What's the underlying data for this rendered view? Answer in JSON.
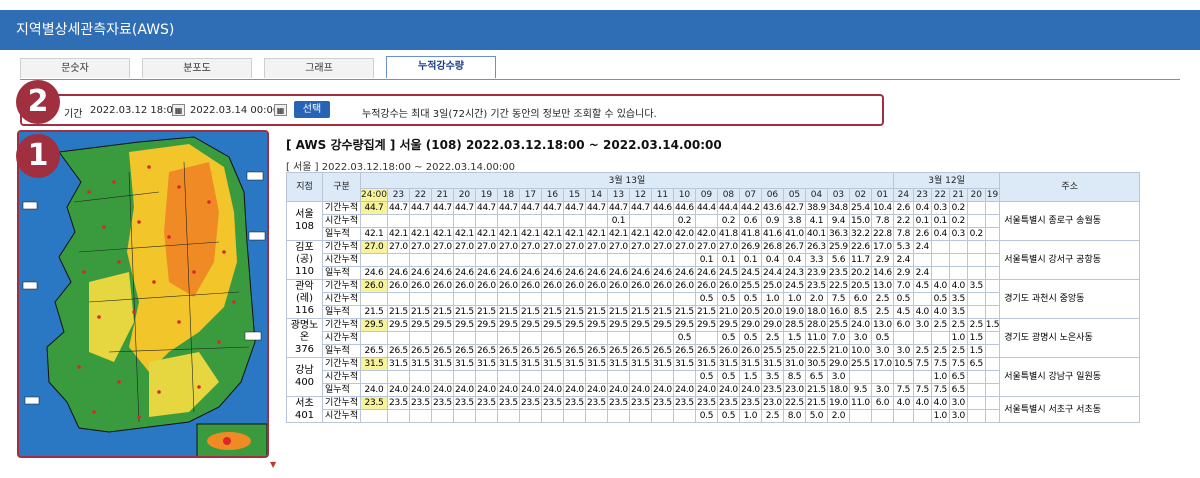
{
  "window_title": "지역별상세관측자료(AWS)",
  "tabs": [
    {
      "label": "문숫자",
      "active": false
    },
    {
      "label": "분포도",
      "active": false
    },
    {
      "label": "그래프",
      "active": false
    },
    {
      "label": "누적강수량",
      "active": true
    }
  ],
  "search": {
    "label": "기간",
    "start": "2022.03.12 18:00",
    "end": "2022.03.14 00:00",
    "button": "선택",
    "info": "누적강수는 최대 3일(72시간) 기간 동안의 정보만 조회할 수 있습니다."
  },
  "badges": [
    "2",
    "1"
  ],
  "colors": {
    "header_blue": "#2f6db5",
    "highlight": "#f7f39a",
    "annotation_red": "#a0303f",
    "button_blue": "#2764b8"
  },
  "report": {
    "title": "[ AWS 강수량집계 ] 서울 (108) 2022.03.12.18:00 ~ 2022.03.14.00:00",
    "subtitle": "[ 서울 ] 2022.03.12.18:00 ~ 2022.03.14.00:00"
  },
  "table": {
    "col_station": "지점",
    "col_kind": "구분",
    "col_address": "주소",
    "day1": "3월 13일",
    "day2": "3월 12일",
    "hours": [
      "24:00",
      "23",
      "22",
      "21",
      "20",
      "19",
      "18",
      "17",
      "16",
      "15",
      "14",
      "13",
      "12",
      "11",
      "10",
      "09",
      "08",
      "07",
      "06",
      "05",
      "04",
      "03",
      "02",
      "01",
      "24",
      "23",
      "22",
      "21",
      "20",
      "19"
    ],
    "stations": [
      {
        "name": "서울\n108",
        "address": "서울특별시 종로구 송월동",
        "rows": [
          {
            "kind": "기간누적",
            "values": [
              "44.7",
              "44.7",
              "44.7",
              "44.7",
              "44.7",
              "44.7",
              "44.7",
              "44.7",
              "44.7",
              "44.7",
              "44.7",
              "44.7",
              "44.7",
              "44.6",
              "44.6",
              "44.4",
              "44.4",
              "44.2",
              "43.6",
              "42.7",
              "38.9",
              "34.8",
              "25.4",
              "10.4",
              "2.6",
              "0.4",
              "0.3",
              "0.2",
              "",
              ""
            ]
          },
          {
            "kind": "시간누적",
            "values": [
              "",
              "",
              "",
              "",
              "",
              "",
              "",
              "",
              "",
              "",
              "",
              "0.1",
              "",
              "",
              "0.2",
              "",
              "0.2",
              "0.6",
              "0.9",
              "3.8",
              "4.1",
              "9.4",
              "15.0",
              "7.8",
              "2.2",
              "0.1",
              "0.1",
              "0.2",
              "",
              ""
            ]
          },
          {
            "kind": "일누적",
            "values": [
              "42.1",
              "42.1",
              "42.1",
              "42.1",
              "42.1",
              "42.1",
              "42.1",
              "42.1",
              "42.1",
              "42.1",
              "42.1",
              "42.1",
              "42.1",
              "42.0",
              "42.0",
              "42.0",
              "41.8",
              "41.8",
              "41.6",
              "41.0",
              "40.1",
              "36.3",
              "32.2",
              "22.8",
              "7.8",
              "2.6",
              "0.4",
              "0.3",
              "0.2",
              ""
            ]
          }
        ]
      },
      {
        "name": "김포(공)\n110",
        "address": "서울특별시 강서구 공항동",
        "rows": [
          {
            "kind": "기간누적",
            "values": [
              "27.0",
              "27.0",
              "27.0",
              "27.0",
              "27.0",
              "27.0",
              "27.0",
              "27.0",
              "27.0",
              "27.0",
              "27.0",
              "27.0",
              "27.0",
              "27.0",
              "27.0",
              "27.0",
              "27.0",
              "26.9",
              "26.8",
              "26.7",
              "26.3",
              "25.9",
              "22.6",
              "17.0",
              "5.3",
              "2.4",
              "",
              "",
              "",
              ""
            ]
          },
          {
            "kind": "시간누적",
            "values": [
              "",
              "",
              "",
              "",
              "",
              "",
              "",
              "",
              "",
              "",
              "",
              "",
              "",
              "",
              "",
              "0.1",
              "0.1",
              "0.1",
              "0.4",
              "0.4",
              "3.3",
              "5.6",
              "11.7",
              "2.9",
              "2.4",
              "",
              "",
              "",
              "",
              ""
            ]
          },
          {
            "kind": "일누적",
            "values": [
              "24.6",
              "24.6",
              "24.6",
              "24.6",
              "24.6",
              "24.6",
              "24.6",
              "24.6",
              "24.6",
              "24.6",
              "24.6",
              "24.6",
              "24.6",
              "24.6",
              "24.6",
              "24.6",
              "24.5",
              "24.5",
              "24.4",
              "24.3",
              "23.9",
              "23.5",
              "20.2",
              "14.6",
              "2.9",
              "2.4",
              "",
              "",
              "",
              ""
            ]
          }
        ]
      },
      {
        "name": "관악(레)\n116",
        "address": "경기도 과천시 중앙동",
        "rows": [
          {
            "kind": "기간누적",
            "values": [
              "26.0",
              "26.0",
              "26.0",
              "26.0",
              "26.0",
              "26.0",
              "26.0",
              "26.0",
              "26.0",
              "26.0",
              "26.0",
              "26.0",
              "26.0",
              "26.0",
              "26.0",
              "26.0",
              "26.0",
              "25.5",
              "25.0",
              "24.5",
              "23.5",
              "22.5",
              "20.5",
              "13.0",
              "7.0",
              "4.5",
              "4.0",
              "4.0",
              "3.5",
              ""
            ]
          },
          {
            "kind": "시간누적",
            "values": [
              "",
              "",
              "",
              "",
              "",
              "",
              "",
              "",
              "",
              "",
              "",
              "",
              "",
              "",
              "",
              "0.5",
              "0.5",
              "0.5",
              "1.0",
              "1.0",
              "2.0",
              "7.5",
              "6.0",
              "2.5",
              "0.5",
              "",
              "0.5",
              "3.5",
              "",
              ""
            ]
          },
          {
            "kind": "일누적",
            "values": [
              "21.5",
              "21.5",
              "21.5",
              "21.5",
              "21.5",
              "21.5",
              "21.5",
              "21.5",
              "21.5",
              "21.5",
              "21.5",
              "21.5",
              "21.5",
              "21.5",
              "21.5",
              "21.5",
              "21.0",
              "20.5",
              "20.0",
              "19.0",
              "18.0",
              "16.0",
              "8.5",
              "2.5",
              "4.5",
              "4.0",
              "4.0",
              "3.5",
              "",
              ""
            ]
          }
        ]
      },
      {
        "name": "광명노온\n376",
        "address": "경기도 광명시 노온사동",
        "rows": [
          {
            "kind": "기간누적",
            "values": [
              "29.5",
              "29.5",
              "29.5",
              "29.5",
              "29.5",
              "29.5",
              "29.5",
              "29.5",
              "29.5",
              "29.5",
              "29.5",
              "29.5",
              "29.5",
              "29.5",
              "29.5",
              "29.5",
              "29.5",
              "29.0",
              "29.0",
              "28.5",
              "28.0",
              "25.5",
              "24.0",
              "13.0",
              "6.0",
              "3.0",
              "2.5",
              "2.5",
              "2.5",
              "1.5"
            ]
          },
          {
            "kind": "시간누적",
            "values": [
              "",
              "",
              "",
              "",
              "",
              "",
              "",
              "",
              "",
              "",
              "",
              "",
              "",
              "",
              "0.5",
              "",
              "0.5",
              "0.5",
              "2.5",
              "1.5",
              "11.0",
              "7.0",
              "3.0",
              "0.5",
              "",
              "",
              "",
              "1.0",
              "1.5",
              ""
            ]
          },
          {
            "kind": "일누적",
            "values": [
              "26.5",
              "26.5",
              "26.5",
              "26.5",
              "26.5",
              "26.5",
              "26.5",
              "26.5",
              "26.5",
              "26.5",
              "26.5",
              "26.5",
              "26.5",
              "26.5",
              "26.5",
              "26.5",
              "26.0",
              "26.0",
              "25.5",
              "25.0",
              "22.5",
              "21.0",
              "10.0",
              "3.0",
              "3.0",
              "2.5",
              "2.5",
              "2.5",
              "1.5",
              ""
            ]
          }
        ]
      },
      {
        "name": "강남\n400",
        "address": "서울특별시 강남구 일원동",
        "rows": [
          {
            "kind": "기간누적",
            "values": [
              "31.5",
              "31.5",
              "31.5",
              "31.5",
              "31.5",
              "31.5",
              "31.5",
              "31.5",
              "31.5",
              "31.5",
              "31.5",
              "31.5",
              "31.5",
              "31.5",
              "31.5",
              "31.5",
              "31.5",
              "31.5",
              "31.5",
              "31.0",
              "30.5",
              "29.0",
              "25.5",
              "17.0",
              "10.5",
              "7.5",
              "7.5",
              "7.5",
              "6.5",
              ""
            ]
          },
          {
            "kind": "시간누적",
            "values": [
              "",
              "",
              "",
              "",
              "",
              "",
              "",
              "",
              "",
              "",
              "",
              "",
              "",
              "",
              "",
              "0.5",
              "0.5",
              "1.5",
              "3.5",
              "8.5",
              "6.5",
              "3.0",
              "",
              "",
              "",
              "",
              "1.0",
              "6.5",
              "",
              ""
            ]
          },
          {
            "kind": "일누적",
            "values": [
              "24.0",
              "24.0",
              "24.0",
              "24.0",
              "24.0",
              "24.0",
              "24.0",
              "24.0",
              "24.0",
              "24.0",
              "24.0",
              "24.0",
              "24.0",
              "24.0",
              "24.0",
              "24.0",
              "24.0",
              "24.0",
              "23.5",
              "23.0",
              "21.5",
              "18.0",
              "9.5",
              "3.0",
              "7.5",
              "7.5",
              "7.5",
              "6.5",
              "",
              ""
            ]
          }
        ]
      },
      {
        "name": "서초\n401",
        "address": "서울특별시 서초구 서초동",
        "rows": [
          {
            "kind": "기간누적",
            "values": [
              "23.5",
              "23.5",
              "23.5",
              "23.5",
              "23.5",
              "23.5",
              "23.5",
              "23.5",
              "23.5",
              "23.5",
              "23.5",
              "23.5",
              "23.5",
              "23.5",
              "23.5",
              "23.5",
              "23.5",
              "23.5",
              "23.0",
              "22.5",
              "21.5",
              "19.0",
              "11.0",
              "6.0",
              "4.0",
              "4.0",
              "4.0",
              "3.0",
              "",
              ""
            ]
          },
          {
            "kind": "시간누적",
            "values": [
              "",
              "",
              "",
              "",
              "",
              "",
              "",
              "",
              "",
              "",
              "",
              "",
              "",
              "",
              "",
              "0.5",
              "0.5",
              "1.0",
              "2.5",
              "8.0",
              "5.0",
              "2.0",
              "",
              "",
              "",
              "",
              "1.0",
              "3.0",
              "",
              ""
            ]
          }
        ]
      }
    ]
  }
}
